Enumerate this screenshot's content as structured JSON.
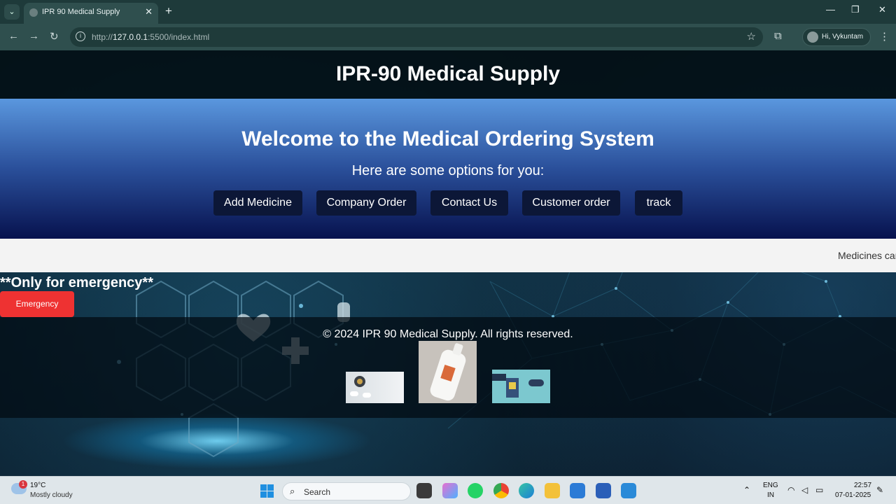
{
  "browser": {
    "tab_title": "IPR 90 Medical Supply",
    "tab_close": "✕",
    "new_tab": "+",
    "url_prefix": "http://",
    "url_host": "127.0.0.1",
    "url_rest": ":5500/index.html",
    "profile_label": "Hi, Vykuntam",
    "window_controls": [
      "—",
      "❐",
      "✕"
    ]
  },
  "site": {
    "header_title": "IPR-90 Medical Supply",
    "hero_title": "Welcome to the Medical Ordering System",
    "hero_subtitle": "Here are some options for you:",
    "buttons": [
      "Add Medicine",
      "Company Order",
      "Contact Us",
      "Customer order",
      "track"
    ],
    "marquee_text": "Medicines can",
    "emergency_title": "**Only for emergency**",
    "emergency_button": "Emergency",
    "footer_text": "© 2024 IPR 90 Medical Supply. All rights reserved.",
    "footer_images": [
      "pills-image",
      "lotion-bottle-image",
      "delivery-image"
    ]
  },
  "taskbar": {
    "temperature": "19°C",
    "condition": "Mostly cloudy",
    "weather_badge": "1",
    "search_label": "Search",
    "language_top": "ENG",
    "language_bottom": "IN",
    "time": "22:57",
    "date": "07-01-2025"
  },
  "colors": {
    "hero_top": "#5a97de",
    "hero_bottom": "#07124e",
    "button_bg": "#0c1737",
    "emergency_red": "#ee3232"
  }
}
